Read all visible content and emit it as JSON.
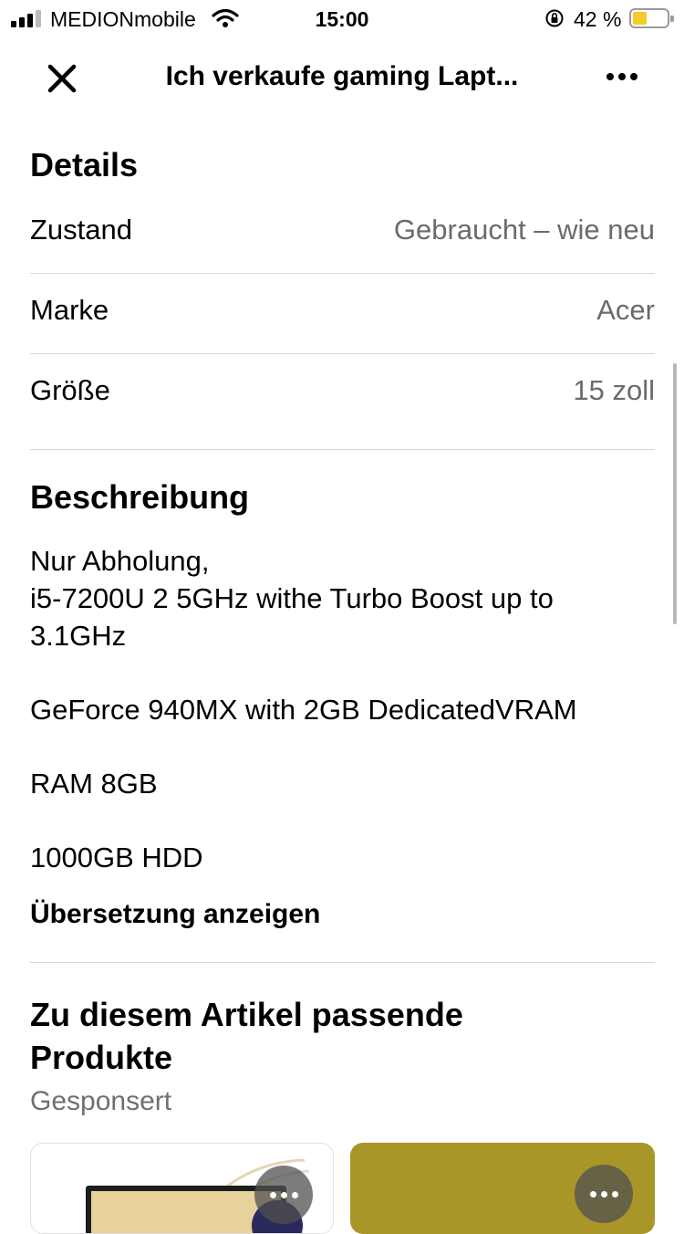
{
  "status_bar": {
    "carrier": "MEDIONmobile",
    "time": "15:00",
    "battery_percent": "42 %",
    "battery_level": 0.42
  },
  "nav": {
    "title": "Ich verkaufe gaming Lapt..."
  },
  "details": {
    "heading": "Details",
    "rows": [
      {
        "label": "Zustand",
        "value": "Gebraucht – wie neu"
      },
      {
        "label": "Marke",
        "value": "Acer"
      },
      {
        "label": "Größe",
        "value": "15 zoll"
      }
    ]
  },
  "description": {
    "heading": "Beschreibung",
    "paragraphs": [
      "Nur Abholung,",
      "i5-7200U 2 5GHz withe Turbo Boost up to 3.1GHz",
      "GeForce 940MX with 2GB DedicatedVRAM",
      "RAM 8GB",
      "1000GB HDD"
    ],
    "translate_label": "Übersetzung anzeigen"
  },
  "related": {
    "heading": "Zu diesem Artikel passende Produkte",
    "sponsored_label": "Gesponsert"
  },
  "colors": {
    "secondary_text": "#6b6b6b",
    "divider": "#d8d8d8",
    "card_accent": "#a99628",
    "battery_fill": "#f5cb2b"
  }
}
